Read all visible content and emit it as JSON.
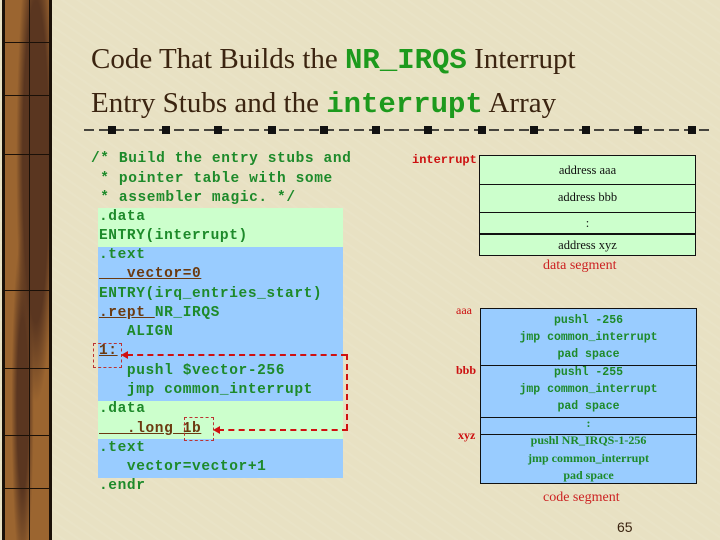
{
  "slide": {
    "title_parts": [
      "Code That Builds the ",
      "NR_IRQS",
      " Interrupt",
      "Entry Stubs and the ",
      "interrupt",
      " Array"
    ],
    "page_number": "65"
  },
  "code": {
    "lines": [
      "/* Build the entry stubs and",
      " * pointer table with some",
      " * assembler magic. */",
      ".data",
      "ENTRY(interrupt)",
      ".text",
      "   vector=0",
      "ENTRY(irq_entries_start)",
      ".rept NR_IRQS",
      "   ALIGN",
      "1:",
      "   pushl $vector-256",
      "   jmp common_interrupt",
      ".data",
      "   .long 1b",
      ".text",
      "   vector=vector+1",
      ".endr"
    ]
  },
  "data_segment": {
    "label": "interrupt",
    "cells": [
      "address aaa",
      "address bbb",
      ":",
      "address xyz"
    ],
    "caption": "data segment"
  },
  "code_segment": {
    "labels": [
      "aaa",
      "bbb",
      "xyz"
    ],
    "lines": [
      "pushl -256",
      "jmp common_interrupt",
      "pad space",
      "pushl -255",
      "jmp common_interrupt",
      "pad space",
      ":",
      "pushl NR_IRQS-1-256",
      "jmp common_interrupt",
      "pad space"
    ],
    "caption": "code segment"
  },
  "colors": {
    "title": "#3b2410",
    "code_green": "#1d8a2a",
    "data_bg": "#ccffcc",
    "text_bg": "#99ccff",
    "arrow_red": "#d01010"
  }
}
